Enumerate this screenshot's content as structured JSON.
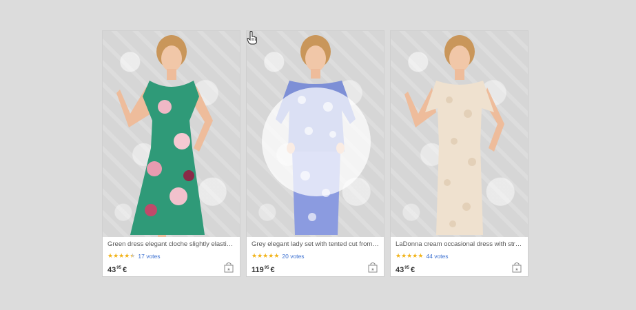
{
  "products": [
    {
      "title": "Green dress elegant cloche slightly elastic fabr...",
      "votes": "17 votes",
      "price_main": "43",
      "price_cents": "95",
      "currency": "€",
      "rating": 4.5,
      "photo_alt": "green floral dress"
    },
    {
      "title": "Grey elegant lady set with tented cut from jac...",
      "votes": "20 votes",
      "price_main": "119",
      "price_cents": "95",
      "currency": "€",
      "rating": 5,
      "photo_alt": "blue patterned skirt set"
    },
    {
      "title": "LaDonna cream occasional dress with straight...",
      "votes": "44 votes",
      "price_main": "43",
      "price_cents": "95",
      "currency": "€",
      "rating": 5,
      "photo_alt": "cream lace dress"
    }
  ],
  "colors": {
    "star": "#f2b41b",
    "votes_link": "#3a6fd0",
    "dress_green": "#2f9a78",
    "dress_blue": "#7d8fd6",
    "dress_cream": "#efe1cf"
  },
  "icons": {
    "rating": "star-icon",
    "cart": "shopping-bag-icon",
    "cursor": "hand-pointer-icon"
  }
}
